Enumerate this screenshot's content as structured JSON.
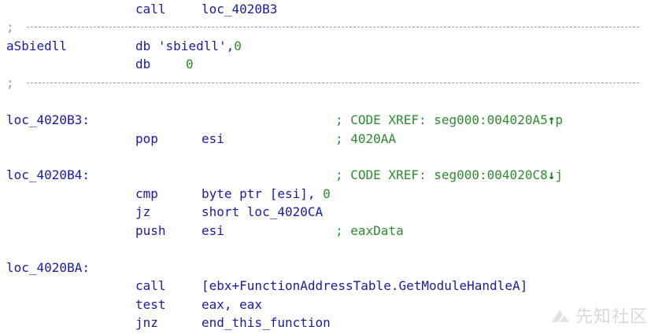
{
  "lines": {
    "l0": {
      "mnemonic": "call",
      "operand": "loc_4020B3"
    },
    "l1": {
      "semicolon": ";"
    },
    "l2": {
      "label": "aSbiedll",
      "mnemonic": "db",
      "operand_prefix": "'sbiedll',",
      "operand_num": "0"
    },
    "l3": {
      "mnemonic": "db",
      "operand_num": "0"
    },
    "l4": {
      "semicolon": ";"
    },
    "l5": {
      "label": "loc_4020B3:",
      "comment_prefix": "; CODE XREF: seg000:004020A5",
      "xref_arrow": "↑",
      "xref_suffix": "p"
    },
    "l6": {
      "mnemonic": "pop",
      "operand": "esi",
      "comment": "; 4020AA"
    },
    "l7": {
      "label": "loc_4020B4:",
      "comment_prefix": "; CODE XREF: seg000:004020C8",
      "xref_arrow": "↓",
      "xref_suffix": "j"
    },
    "l8": {
      "mnemonic": "cmp",
      "operand_prefix": "byte ptr [esi], ",
      "operand_num": "0"
    },
    "l9": {
      "mnemonic": "jz",
      "operand": "short loc_4020CA"
    },
    "l10": {
      "mnemonic": "push",
      "operand": "esi",
      "comment": "; eaxData"
    },
    "l11": {
      "label": "loc_4020BA:"
    },
    "l12": {
      "mnemonic": "call",
      "operand": "[ebx+FunctionAddressTable.GetModuleHandleA]"
    },
    "l13": {
      "mnemonic": "test",
      "operand": "eax, eax"
    },
    "l14": {
      "mnemonic": "jnz",
      "operand": "end_this_function"
    }
  },
  "watermark": {
    "text": "先知社区"
  },
  "colors": {
    "code": "#1a1aa6",
    "comment": "#2e8b2e",
    "separator": "#9a9a9a"
  }
}
